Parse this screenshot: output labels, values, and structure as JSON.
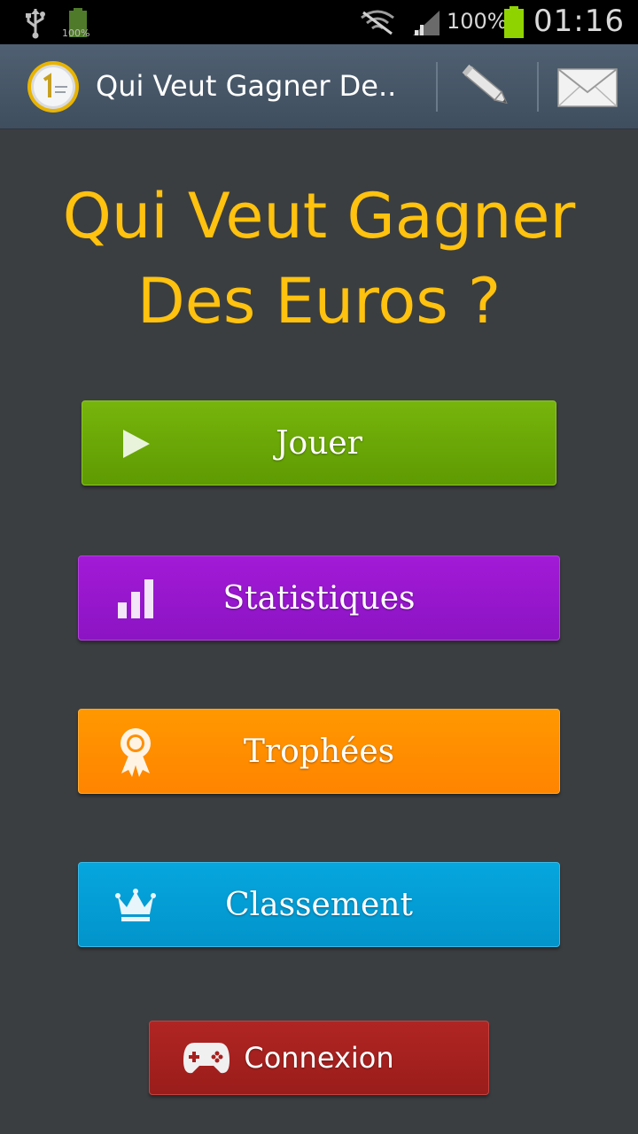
{
  "status_bar": {
    "mini_battery_label": "100%",
    "battery_percent": "100%",
    "time": "01:16",
    "icons": [
      "usb-icon",
      "battery-icon",
      "wifi-off-icon",
      "signal-icon",
      "battery-icon"
    ]
  },
  "action_bar": {
    "title": "Qui Veut Gagner De..",
    "logo_icon": "euro-coin-icon",
    "actions": [
      {
        "name": "edit",
        "icon": "pencil-icon"
      },
      {
        "name": "mail",
        "icon": "envelope-icon"
      }
    ]
  },
  "headline": {
    "line1": "Qui Veut Gagner",
    "line2": "Des Euros ?"
  },
  "menu": {
    "play": {
      "label": "Jouer",
      "icon": "play-icon",
      "color": "#6aa807"
    },
    "stats": {
      "label": "Statistiques",
      "icon": "bar-chart-icon",
      "color": "#9617cd"
    },
    "trophies": {
      "label": "Trophées",
      "icon": "ribbon-icon",
      "color": "#ff8c00"
    },
    "ranking": {
      "label": "Classement",
      "icon": "crown-icon",
      "color": "#049dd5"
    },
    "login": {
      "label": "Connexion",
      "icon": "gamepad-icon",
      "color": "#a5211f"
    }
  },
  "colors": {
    "background": "#3b3e41",
    "headline": "#ffc20e",
    "action_bar": "#475768"
  }
}
